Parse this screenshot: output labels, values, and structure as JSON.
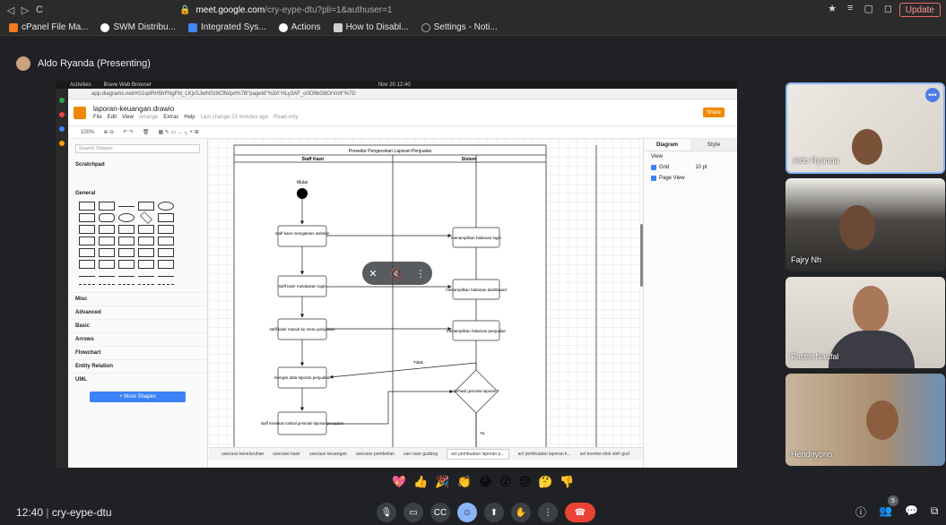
{
  "browser": {
    "nav": [
      "◁",
      "▷",
      "C"
    ],
    "url_host": "meet.google.com",
    "url_path": "/cry-eype-dtu?pli=1&authuser=1",
    "update_label": "Update"
  },
  "bookmarks": [
    {
      "label": "cPanel File Ma...",
      "color": "#f07b22"
    },
    {
      "label": "SWM Distribu...",
      "color": "#ffffff"
    },
    {
      "label": "Integrated Sys...",
      "color": "#4285f4"
    },
    {
      "label": "Actions",
      "color": "#ffffff"
    },
    {
      "label": "How to Disabl...",
      "color": "#cfcfcf"
    },
    {
      "label": "Settings - Noti...",
      "color": "#aaaaaa"
    }
  ],
  "presenter": {
    "label": "Aldo Ryanda (Presenting)"
  },
  "shared": {
    "os_activities": "Activities",
    "os_browser": "Brave Web Browser",
    "os_clock": "Nov 20  12:40",
    "inner_url": "app.diagrams.net/#G1qoRH5hFNgFkt_LKjxSJwhI0z9Cffetp#%7B\"pageId\"%3A\"HLy3AF_o0O9bG8OrVnIt\"%7D",
    "doc_title": "laporan-keuangan.drawio",
    "menu": [
      "File",
      "Edit",
      "View",
      "Arrange",
      "Extras",
      "Help"
    ],
    "last_change": "Last change 23 minutes ago",
    "read_only": "Read-only",
    "share_label": "Share",
    "zoom": "100%",
    "search_placeholder": "Search Shapes",
    "scratchpad": "Scratchpad",
    "general": "General",
    "categories": [
      "Misc",
      "Advanced",
      "Basic",
      "Arrows",
      "Flowchart",
      "Entity Relation",
      "UML"
    ],
    "more_shapes": "+ More Shapes",
    "format_tabs": [
      "Diagram",
      "Style"
    ],
    "format_view": "View",
    "format_grid": "Grid",
    "format_grid_size": "10 pt",
    "format_pageview": "Page View",
    "page_tabs": [
      "usecase keseluruhan",
      "usecase kasir",
      "usecase keuangan",
      "usecase pembelian",
      "use case gudang",
      "act pembuatan laporan p...",
      "act pembuatan laporan k...",
      "act koreksi stok oleh gud"
    ],
    "active_page_tab": 5
  },
  "diagram": {
    "title": "Prosedur Pengecekan Laporan Penjualan",
    "lane_left": "Staff Kasir",
    "lane_right": "Sistem",
    "start": "Mulai",
    "steps_left": [
      "staff kasir mengakses website",
      "staff kasir melakukan login",
      "staff kasir masuk ke menu penjualan",
      "mengisi data laporan penjualan",
      "staff menekan tombol generate laporan penjualan"
    ],
    "steps_right": [
      "menampilkan halaman login",
      "menampilkan halaman dashboard",
      "menampilkan halaman penjualan"
    ],
    "decision": "berhasil generate laporan ?",
    "label_no": "Tidak",
    "label_yes": "Ya"
  },
  "participants": [
    {
      "name": "Aldo Ryanda",
      "bg": "#e8e6e1"
    },
    {
      "name": "Fajry Nh",
      "bg": "#5d5a56"
    },
    {
      "name": "Fachri Naufal",
      "bg": "#d8d4cc"
    },
    {
      "name": "Hendriyono",
      "bg": "#b9a288"
    }
  ],
  "meeting": {
    "time": "12:40",
    "code": "cry-eype-dtu",
    "people_count": "5"
  },
  "reactions": [
    "💖",
    "👍",
    "🎉",
    "👏",
    "😂",
    "😮",
    "😢",
    "🤔",
    "👎"
  ]
}
